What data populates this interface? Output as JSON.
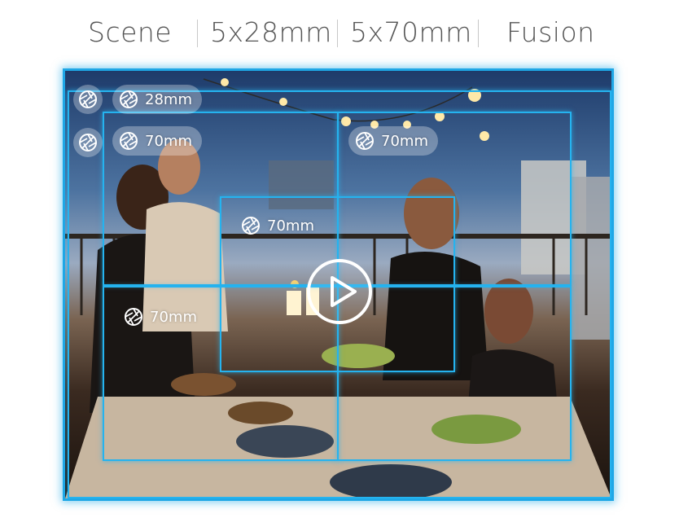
{
  "tabs": [
    {
      "label": "Scene"
    },
    {
      "label": "5x28mm"
    },
    {
      "label": "5x70mm"
    },
    {
      "label": "Fusion"
    }
  ],
  "badges": {
    "wide_28": "28mm",
    "tele_top_left": "70mm",
    "tele_top_right": "70mm",
    "tele_center": "70mm",
    "tele_bottom_left": "70mm"
  },
  "icons": {
    "aperture": "aperture-icon",
    "play": "play-icon"
  },
  "colors": {
    "frame_accent": "#25b3ef",
    "tab_text": "#555555"
  }
}
